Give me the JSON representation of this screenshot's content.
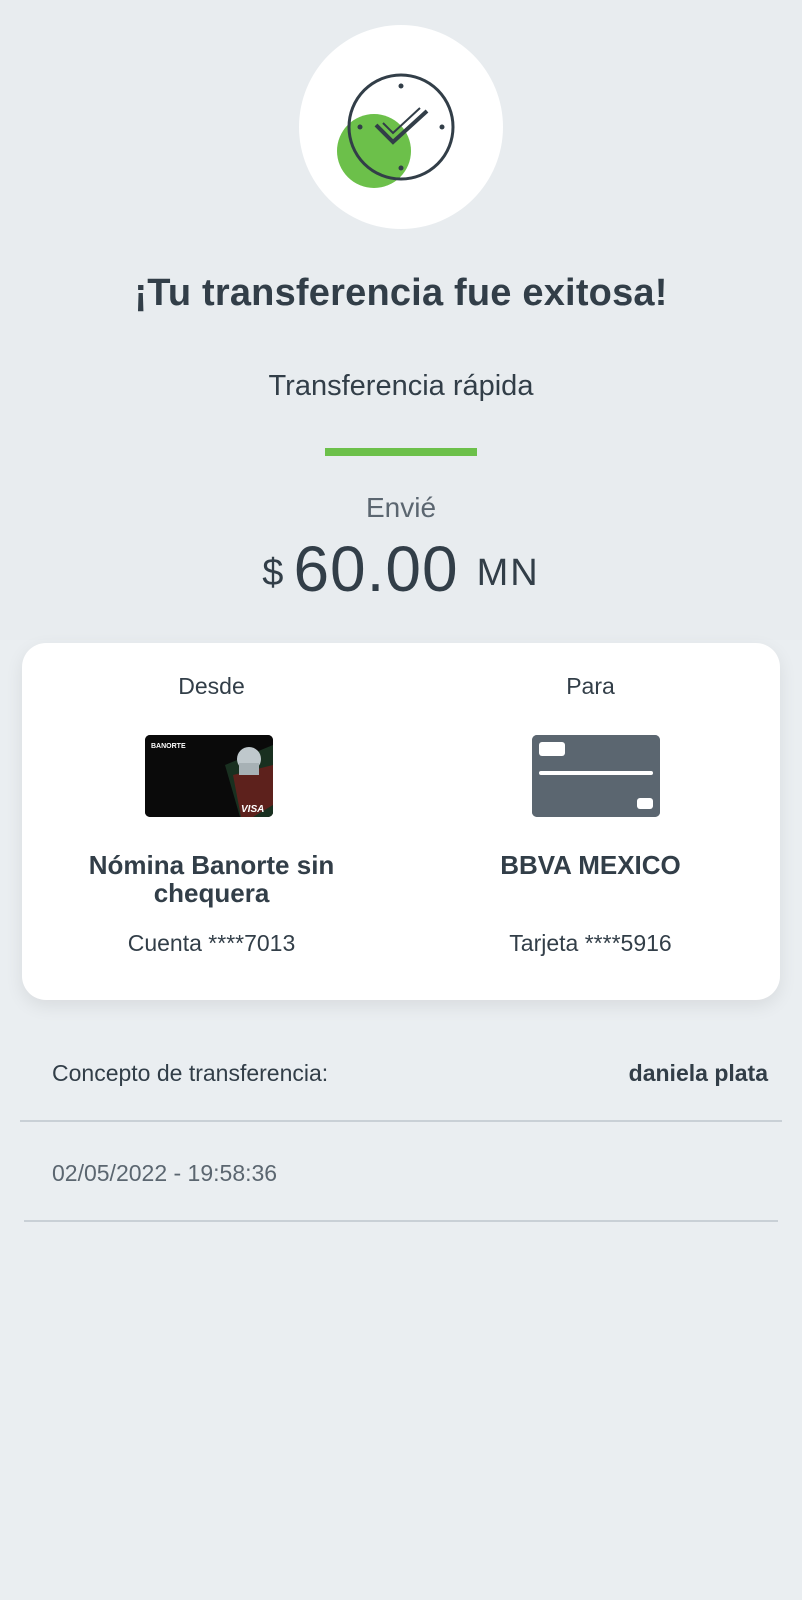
{
  "status": {
    "title": "¡Tu transferencia fue exitosa!",
    "subtitle": "Transferencia rápida"
  },
  "amount": {
    "label": "Envié",
    "currency_symbol": "$",
    "value": "60.00",
    "unit": "MN"
  },
  "accounts": {
    "from": {
      "heading": "Desde",
      "card_brand": "BANORTE",
      "card_network": "VISA",
      "name": "Nómina Banorte sin chequera",
      "number": "Cuenta ****7013"
    },
    "to": {
      "heading": "Para",
      "name": "BBVA MEXICO",
      "number": "Tarjeta ****5916"
    }
  },
  "details": {
    "concept_label": "Concepto de transferencia:",
    "concept_value": "daniela plata",
    "datetime": "02/05/2022 - 19:58:36"
  },
  "colors": {
    "accent_green": "#6cc04a",
    "text_dark": "#323e48",
    "card_gray": "#5b6670"
  }
}
